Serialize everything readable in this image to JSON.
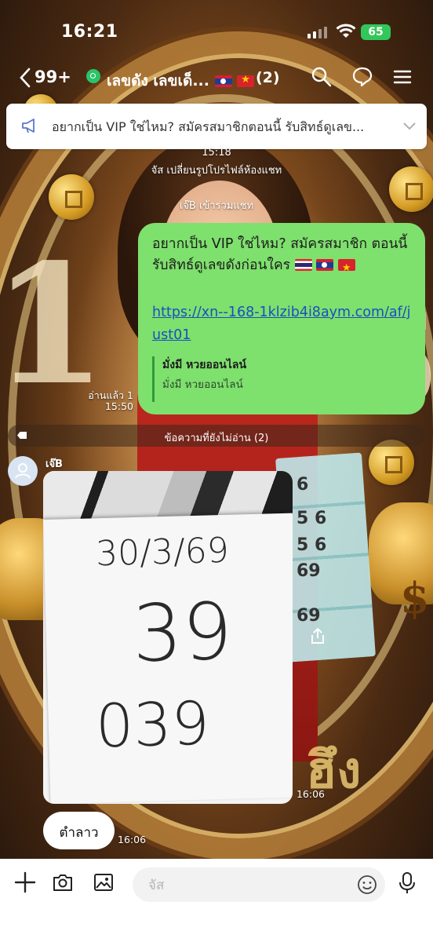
{
  "status_bar": {
    "time": "16:21",
    "battery": "65"
  },
  "header": {
    "unread_count": "99+",
    "chat_title": "เลขดัง เลขเด็...",
    "member_count": "(2)",
    "icons": [
      "back-chevron-icon",
      "search-icon",
      "chat-bubble-icon",
      "menu-icon"
    ]
  },
  "announcement": {
    "text": "อยากเป็น VIP ใช่ไหม? สมัครสมาชิกตอนนี้ รับสิทธ์ดูเลข..."
  },
  "system_messages": {
    "time": "15:18",
    "profile_changed": "จัส เปลี่ยนรูปโปรไฟล์ห้องแชท",
    "joined": "เจ๊B เข้าร่วมแชท"
  },
  "outgoing_message": {
    "text": "อยากเป็น VIP ใช่ไหม? สมัครสมาชิก ตอนนี้ รับสิทธ์ดูเลขดังก่อนใคร",
    "link": "https://xn--168-1klzib4i8aym.com/af/just01",
    "preview_title": "มั่งมี หวยออนไลน์",
    "preview_subtitle": "มั่งมี หวยออนไลน์",
    "read_status": "อ่านแล้ว 1",
    "time": "15:50"
  },
  "unread_divider": "ข้อความที่ยังไม่อ่าน (2)",
  "incoming": {
    "sender": "เจ๊B",
    "photo_handwriting": {
      "date": "30/3/69",
      "line1": "39",
      "line2": "039"
    },
    "photo_time": "16:06",
    "text": "ตำลาว",
    "text_time": "16:06"
  },
  "input_bar": {
    "placeholder": "จัส"
  },
  "colors": {
    "outgoing_bubble": "#7ee06d",
    "link": "#1a4fbf",
    "battery": "#32c75a"
  }
}
